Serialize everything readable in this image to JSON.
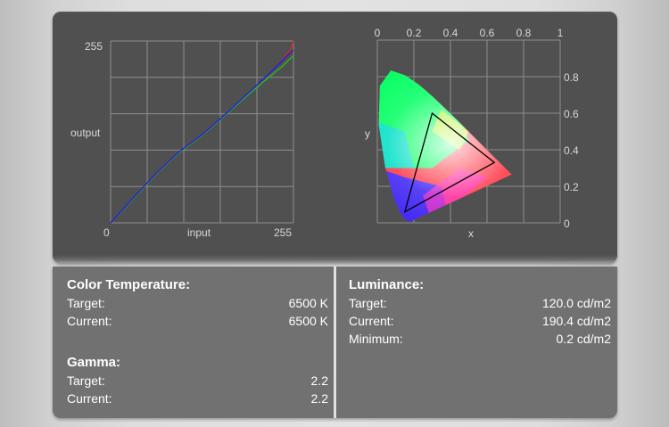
{
  "curve_chart": {
    "y_max_label": "255",
    "y_label": "output",
    "x_min_label": "0",
    "x_label": "input",
    "x_max_label": "255"
  },
  "cie_chart": {
    "x_ticks": [
      "0",
      "0.2",
      "0.4",
      "0.6",
      "0.8",
      "1"
    ],
    "y_ticks": [
      "0.8",
      "0.6",
      "0.4",
      "0.2",
      "0"
    ],
    "x_label": "x",
    "y_label": "y"
  },
  "chart_data": [
    {
      "type": "line",
      "xlim": [
        0,
        255
      ],
      "ylim": [
        0,
        255
      ],
      "xlabel": "input",
      "ylabel": "output",
      "grid": true,
      "series_colors": [
        "#2020e0",
        "#20c020",
        "#e02020"
      ],
      "x": [
        0,
        20,
        40,
        64,
        96,
        128,
        160,
        192,
        224,
        240,
        250,
        255
      ],
      "series": [
        {
          "values": [
            0,
            22,
            44,
            70,
            100,
            124,
            152,
            182,
            212,
            228,
            238,
            242
          ]
        },
        {
          "values": [
            0,
            21,
            43,
            69,
            99,
            123,
            151,
            180,
            207,
            220,
            230,
            234
          ]
        },
        {
          "values": [
            0,
            22,
            44,
            70,
            100,
            124,
            152,
            182,
            212,
            229,
            241,
            255
          ]
        }
      ]
    },
    {
      "type": "scatter",
      "xlim": [
        0,
        1
      ],
      "ylim": [
        0,
        1
      ],
      "xlabel": "x",
      "ylabel": "y",
      "grid": true,
      "gamut_triangle": [
        [
          0.64,
          0.33
        ],
        [
          0.3,
          0.6
        ],
        [
          0.15,
          0.06
        ]
      ]
    }
  ],
  "color_temperature": {
    "title": "Color Temperature:",
    "target_label": "Target:",
    "target_value": "6500 K",
    "current_label": "Current:",
    "current_value": "6500 K"
  },
  "gamma": {
    "title": "Gamma:",
    "target_label": "Target:",
    "target_value": "2.2",
    "current_label": "Current:",
    "current_value": "2.2"
  },
  "luminance": {
    "title": "Luminance:",
    "target_label": "Target:",
    "target_value": "120.0 cd/m2",
    "current_label": "Current:",
    "current_value": "190.4 cd/m2",
    "minimum_label": "Minimum:",
    "minimum_value": "0.2 cd/m2"
  }
}
